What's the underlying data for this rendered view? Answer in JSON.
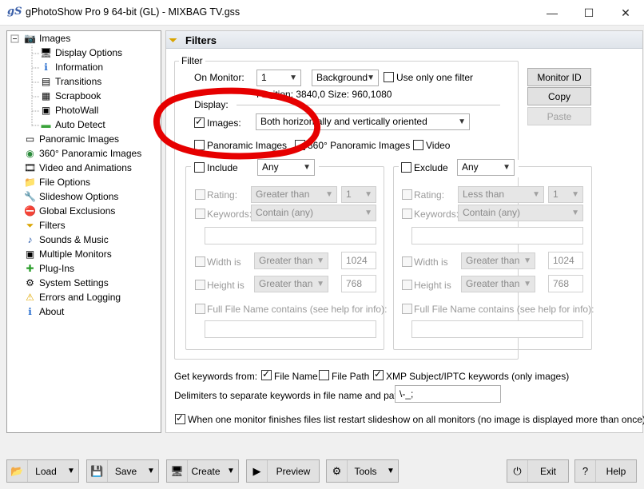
{
  "window": {
    "app_icon": "gS",
    "title": "gPhotoShow Pro 9 64-bit (GL) - MIXBAG TV.gss",
    "minimize": "—",
    "maximize": "☐",
    "close": "✕"
  },
  "tree": {
    "items": [
      {
        "label": "Images",
        "icon": "camera-icon"
      },
      {
        "label": "Display Options",
        "icon": "display-icon"
      },
      {
        "label": "Information",
        "icon": "info-icon"
      },
      {
        "label": "Transitions",
        "icon": "transitions-icon"
      },
      {
        "label": "Scrapbook",
        "icon": "scrapbook-icon"
      },
      {
        "label": "PhotoWall",
        "icon": "photowall-icon"
      },
      {
        "label": "Auto Detect",
        "icon": "auto-detect-icon"
      },
      {
        "label": "Panoramic Images",
        "icon": "panoramic-icon"
      },
      {
        "label": "360° Panoramic Images",
        "icon": "globe-icon"
      },
      {
        "label": "Video and Animations",
        "icon": "video-icon"
      },
      {
        "label": "File Options",
        "icon": "folder-icon"
      },
      {
        "label": "Slideshow Options",
        "icon": "tools-icon"
      },
      {
        "label": "Global Exclusions",
        "icon": "exclusion-icon"
      },
      {
        "label": "Filters",
        "icon": "filter-icon"
      },
      {
        "label": "Sounds & Music",
        "icon": "music-icon"
      },
      {
        "label": "Multiple Monitors",
        "icon": "monitors-icon"
      },
      {
        "label": "Plug-Ins",
        "icon": "plugin-icon"
      },
      {
        "label": "System Settings",
        "icon": "settings-icon"
      },
      {
        "label": "Errors and Logging",
        "icon": "warning-icon"
      },
      {
        "label": "About",
        "icon": "about-icon"
      }
    ]
  },
  "panel": {
    "title": "Filters",
    "filter_group": "Filter",
    "on_monitor_label": "On Monitor:",
    "monitor_value": "1",
    "background_value": "Background",
    "use_only_one_filter": "Use only one filter",
    "position_size": "Position: 3840,0  Size: 960,1080",
    "display_label": "Display:",
    "images_label": "Images:",
    "orientation_value": "Both horizontally and vertically oriented",
    "panoramic_label": "Panoramic Images",
    "panoramic360_label": "360° Panoramic Images",
    "video_label": "Video",
    "buttons": {
      "monitor_id": "Monitor ID",
      "copy": "Copy",
      "paste": "Paste"
    },
    "include": {
      "label": "Include",
      "mode": "Any",
      "rating_label": "Rating:",
      "rating_op": "Greater than",
      "rating_value": "1",
      "keywords_label": "Keywords:",
      "keywords_mode": "Contain (any)",
      "width_label": "Width is",
      "width_op": "Greater than",
      "width_value": "1024",
      "height_label": "Height is",
      "height_op": "Greater than",
      "height_value": "768",
      "fullname_label": "Full File Name contains (see help for info):"
    },
    "exclude": {
      "label": "Exclude",
      "mode": "Any",
      "rating_label": "Rating:",
      "rating_op": "Less than",
      "rating_value": "1",
      "keywords_label": "Keywords:",
      "keywords_mode": "Contain (any)",
      "width_label": "Width is",
      "width_op": "Greater than",
      "width_value": "1024",
      "height_label": "Height is",
      "height_op": "Greater than",
      "height_value": "768",
      "fullname_label": "Full File Name contains (see help for info):"
    },
    "keywords_from_label": "Get keywords from:",
    "file_name_label": "File Name",
    "file_path_label": "File Path",
    "xmp_label": "XMP Subject/IPTC keywords (only images)",
    "delimiters_label": "Delimiters to separate keywords in file name and path:",
    "delimiters_value": "\\-_;",
    "restart_label": "When one monitor finishes files list restart slideshow on all monitors (no image is displayed more than once)"
  },
  "bottom": {
    "load": "Load",
    "save": "Save",
    "create": "Create",
    "preview": "Preview",
    "tools": "Tools",
    "exit": "Exit",
    "help": "Help"
  },
  "colors": {
    "annotation": "#e60000",
    "title_accent": "#3a5fa8"
  }
}
